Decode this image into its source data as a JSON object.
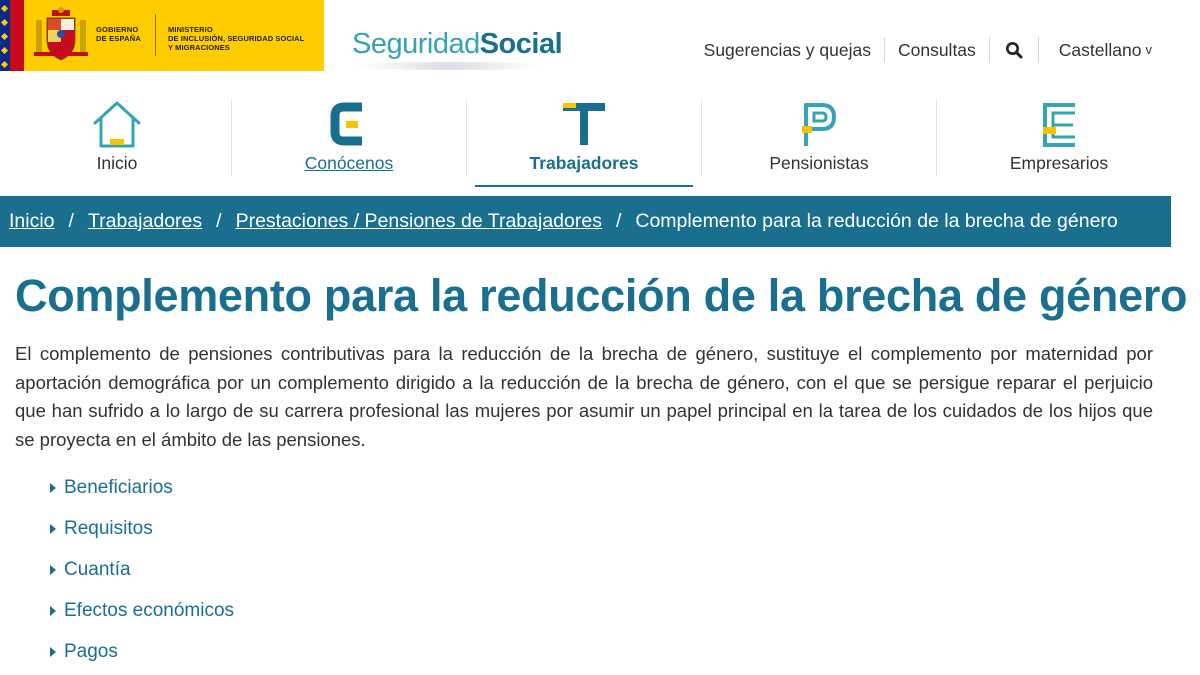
{
  "header": {
    "gov_line1": "GOBIERNO",
    "gov_line2": "DE ESPAÑA",
    "ministry_line1": "MINISTERIO",
    "ministry_line2": "DE INCLUSIÓN, SEGURIDAD SOCIAL",
    "ministry_line3": "Y MIGRACIONES",
    "logo_light": "Seguridad",
    "logo_bold": "Social",
    "links": {
      "suggestions": "Sugerencias y quejas",
      "queries": "Consultas",
      "search_icon": "search-icon",
      "language": "Castellano",
      "language_caret": "v"
    }
  },
  "nav": {
    "items": [
      {
        "label": "Inicio",
        "icon": "house-icon"
      },
      {
        "label": "Conócenos",
        "icon": "c-letter-icon"
      },
      {
        "label": "Trabajadores",
        "icon": "t-letter-icon"
      },
      {
        "label": "Pensionistas",
        "icon": "p-letter-icon"
      },
      {
        "label": "Empresarios",
        "icon": "e-letter-icon"
      }
    ]
  },
  "breadcrumb": {
    "items": [
      "Inicio",
      "Trabajadores",
      "Prestaciones / Pensiones de Trabajadores",
      "Complemento para la reducción de la brecha de género"
    ],
    "separator": "/"
  },
  "content": {
    "title": "Complemento para la reducción de la brecha de género",
    "intro": "El complemento de pensiones contributivas para la reducción de la brecha de género,  sustituye el complemento por maternidad por aportación demográfica por un complemento dirigido a la reducción de la brecha de género, con el que se persigue reparar el perjuicio que han sufrido a lo largo de su carrera profesional las mujeres por asumir un papel principal en la tarea de los cuidados de los hijos que se proyecta en el ámbito de las pensiones.",
    "links": [
      "Beneficiarios",
      "Requisitos",
      "Cuantía",
      "Efectos económicos",
      "Pagos"
    ]
  },
  "colors": {
    "primary": "#1a6f8f",
    "accent": "#36a3b5",
    "yellow": "#f5c400",
    "gov_yellow": "#FFCC00"
  }
}
